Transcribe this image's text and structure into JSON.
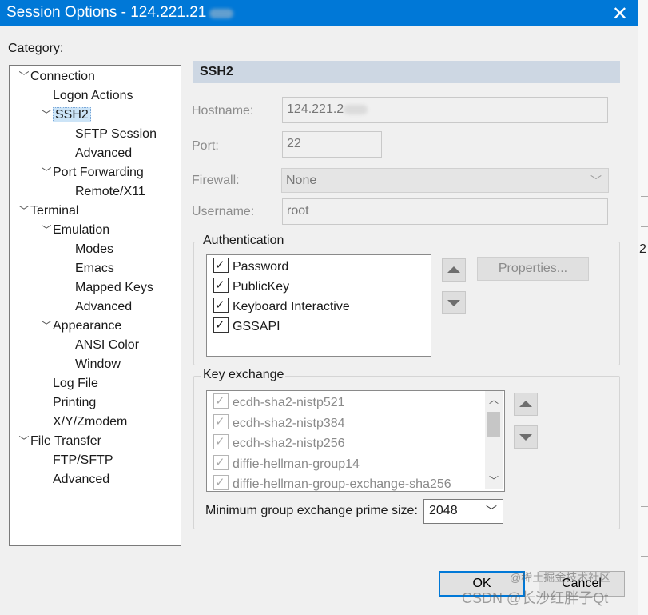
{
  "window": {
    "title": "Session Options - 124.221.21",
    "close_icon": "close-icon"
  },
  "category_label": "Category:",
  "tree": [
    {
      "label": "Connection",
      "level": 0,
      "expanded": true
    },
    {
      "label": "Logon Actions",
      "level": 1
    },
    {
      "label": "SSH2",
      "level": 1,
      "expanded": true,
      "selected": true
    },
    {
      "label": "SFTP Session",
      "level": 2
    },
    {
      "label": "Advanced",
      "level": 2
    },
    {
      "label": "Port Forwarding",
      "level": 1,
      "expanded": true
    },
    {
      "label": "Remote/X11",
      "level": 2
    },
    {
      "label": "Terminal",
      "level": 0,
      "expanded": true
    },
    {
      "label": "Emulation",
      "level": 1,
      "expanded": true
    },
    {
      "label": "Modes",
      "level": 2
    },
    {
      "label": "Emacs",
      "level": 2
    },
    {
      "label": "Mapped Keys",
      "level": 2
    },
    {
      "label": "Advanced",
      "level": 2
    },
    {
      "label": "Appearance",
      "level": 1,
      "expanded": true
    },
    {
      "label": "ANSI Color",
      "level": 2
    },
    {
      "label": "Window",
      "level": 2
    },
    {
      "label": "Log File",
      "level": 1
    },
    {
      "label": "Printing",
      "level": 1
    },
    {
      "label": "X/Y/Zmodem",
      "level": 1
    },
    {
      "label": "File Transfer",
      "level": 0,
      "expanded": true
    },
    {
      "label": "FTP/SFTP",
      "level": 1
    },
    {
      "label": "Advanced",
      "level": 1
    }
  ],
  "section_title": "SSH2",
  "hostname": {
    "label": "Hostname:",
    "value": "124.221.2"
  },
  "port": {
    "label": "Port:",
    "value": "22"
  },
  "firewall": {
    "label": "Firewall:",
    "value": "None"
  },
  "username": {
    "label": "Username:",
    "value": "root"
  },
  "authentication": {
    "label": "Authentication",
    "items": [
      {
        "label": "Password",
        "checked": true
      },
      {
        "label": "PublicKey",
        "checked": true
      },
      {
        "label": "Keyboard Interactive",
        "checked": true
      },
      {
        "label": "GSSAPI",
        "checked": true
      }
    ],
    "properties_label": "Properties..."
  },
  "key_exchange": {
    "label": "Key exchange",
    "items": [
      {
        "label": "ecdh-sha2-nistp521",
        "checked": true
      },
      {
        "label": "ecdh-sha2-nistp384",
        "checked": true
      },
      {
        "label": "ecdh-sha2-nistp256",
        "checked": true
      },
      {
        "label": "diffie-hellman-group14",
        "checked": true
      },
      {
        "label": "diffie-hellman-group-exchange-sha256",
        "checked": true
      }
    ]
  },
  "min_group": {
    "label": "Minimum group exchange prime size:",
    "value": "2048"
  },
  "buttons": {
    "ok": "OK",
    "cancel": "Cancel"
  },
  "watermark": "CSDN @长沙红胖子Qt",
  "watermark_top": "@稀土掘金技术社区",
  "outside_char": "2",
  "colors": {
    "titlebar": "#0078d7",
    "section_header": "#cdd7e3",
    "selection": "#cce4f7"
  }
}
